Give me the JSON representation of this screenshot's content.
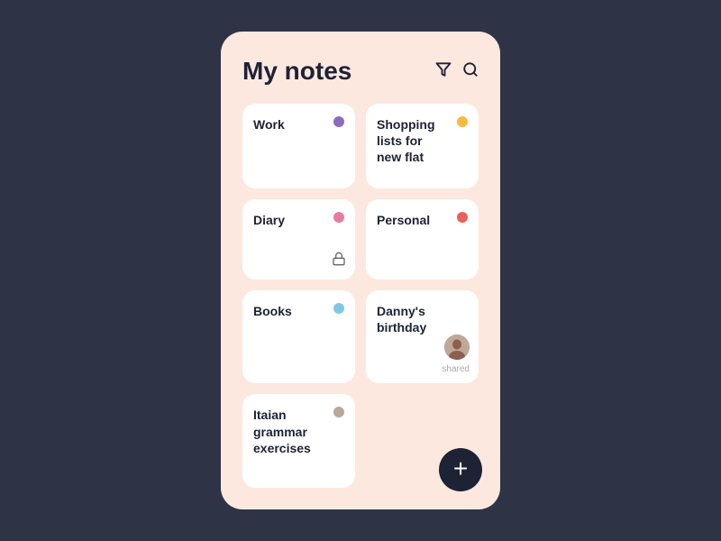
{
  "header": {
    "title": "My notes",
    "filter_icon": "▽",
    "search_icon": "⌕"
  },
  "notes": [
    {
      "id": "work",
      "title": "Work",
      "dot_color": "#8b6bbf",
      "has_lock": false,
      "is_shared": false
    },
    {
      "id": "shopping",
      "title": "Shopping lists for new flat",
      "dot_color": "#f5b942",
      "has_lock": false,
      "is_shared": false
    },
    {
      "id": "diary",
      "title": "Diary",
      "dot_color": "#e87ca0",
      "has_lock": true,
      "is_shared": false
    },
    {
      "id": "personal",
      "title": "Personal",
      "dot_color": "#e8605a",
      "has_lock": false,
      "is_shared": false
    },
    {
      "id": "books",
      "title": "Books",
      "dot_color": "#7ec8e3",
      "has_lock": false,
      "is_shared": false
    },
    {
      "id": "dannys-birthday",
      "title": "Danny's birthday",
      "dot_color": null,
      "has_lock": false,
      "is_shared": true,
      "shared_label": "shared"
    },
    {
      "id": "italian-grammar",
      "title": "Itaian grammar exercises",
      "dot_color": "#b8a898",
      "has_lock": false,
      "is_shared": false
    }
  ],
  "fab": {
    "label": "+"
  }
}
